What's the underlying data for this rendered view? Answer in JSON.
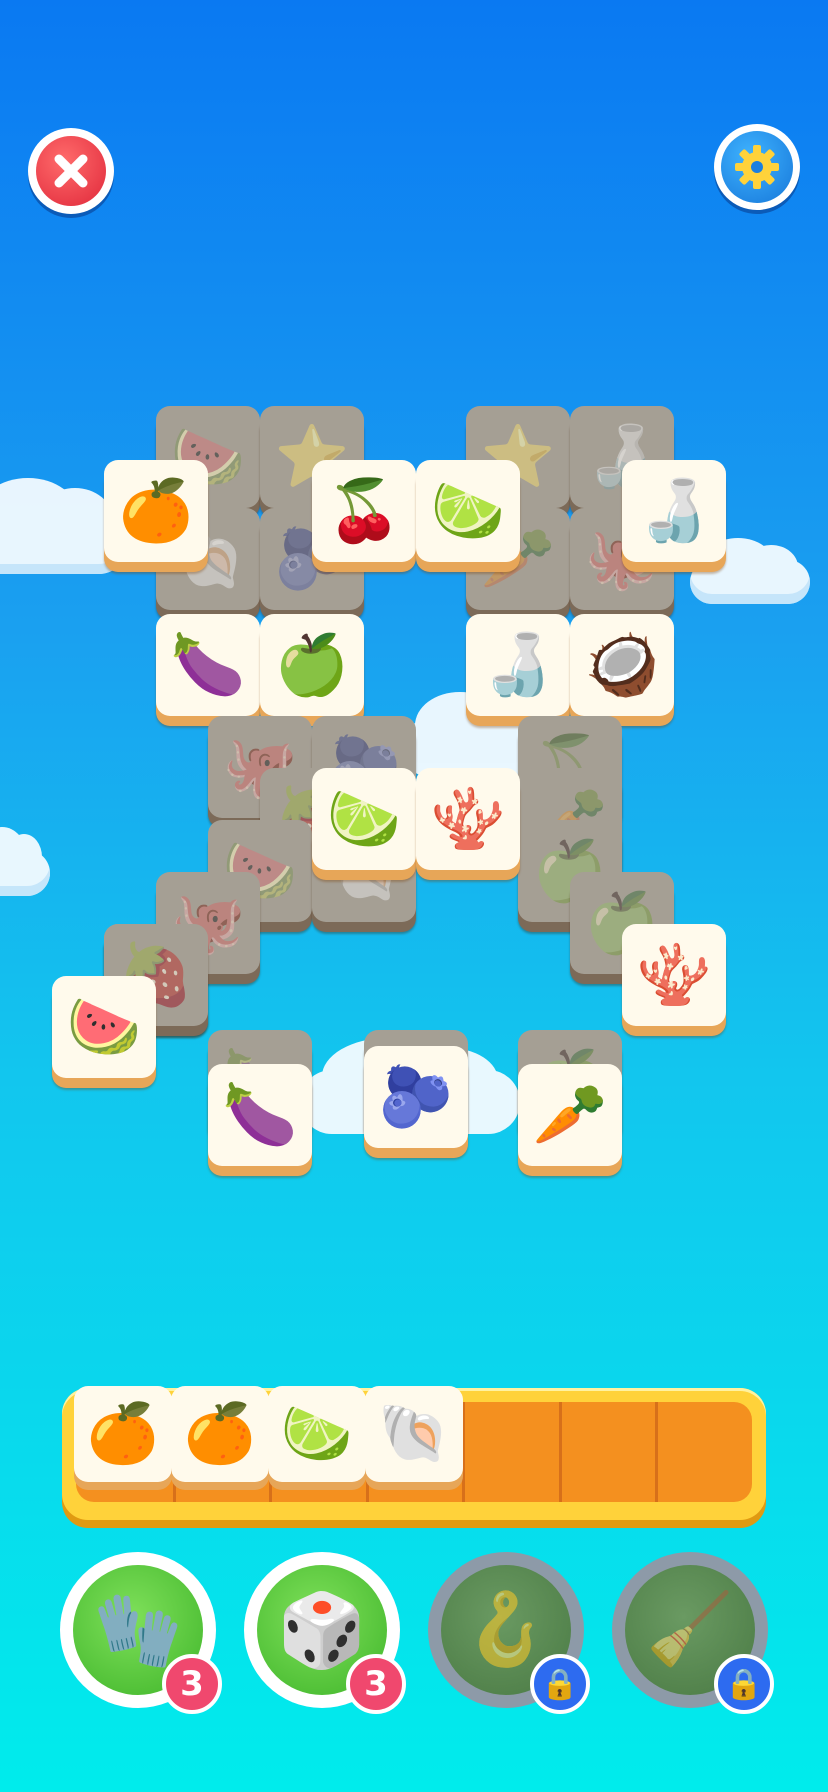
{
  "top_bar": {
    "close_icon": "close-icon",
    "settings_icon": "gear-icon"
  },
  "tiles": [
    {
      "glyph": "🍉",
      "dim": true
    },
    {
      "glyph": "⭐",
      "dim": true
    },
    {
      "glyph": "⭐",
      "dim": true
    },
    {
      "glyph": "🍶",
      "dim": true
    },
    {
      "glyph": "🐚",
      "dim": true
    },
    {
      "glyph": "🫐",
      "dim": true
    },
    {
      "glyph": "🥕",
      "dim": true
    },
    {
      "glyph": "🐙",
      "dim": true
    },
    {
      "glyph": "🍊",
      "dim": false
    },
    {
      "glyph": "🍒",
      "dim": false
    },
    {
      "glyph": "🍋‍🟩",
      "dim": false
    },
    {
      "glyph": "🍶",
      "dim": false
    },
    {
      "glyph": "🍆",
      "dim": false
    },
    {
      "glyph": "🍏",
      "dim": false
    },
    {
      "glyph": "🍶",
      "dim": false
    },
    {
      "glyph": "🥥",
      "dim": false
    },
    {
      "glyph": "🐙",
      "dim": true
    },
    {
      "glyph": "🫐",
      "dim": true
    },
    {
      "glyph": "🍒",
      "dim": true
    },
    {
      "glyph": "🍓",
      "dim": true
    },
    {
      "glyph": "🥕",
      "dim": true
    },
    {
      "glyph": "🍉",
      "dim": true
    },
    {
      "glyph": "🐚",
      "dim": true
    },
    {
      "glyph": "🍏",
      "dim": true
    },
    {
      "glyph": "🍓",
      "dim": true
    },
    {
      "glyph": "🍋‍🟩",
      "dim": false
    },
    {
      "glyph": "🪸",
      "dim": false
    },
    {
      "glyph": "🐙",
      "dim": true
    },
    {
      "glyph": "🍏",
      "dim": true
    },
    {
      "glyph": "🍓",
      "dim": true
    },
    {
      "glyph": "🪸",
      "dim": false
    },
    {
      "glyph": "🍉",
      "dim": false
    },
    {
      "glyph": "🍆",
      "dim": true
    },
    {
      "glyph": "🥥",
      "dim": true
    },
    {
      "glyph": "🍏",
      "dim": true
    },
    {
      "glyph": "🍆",
      "dim": false
    },
    {
      "glyph": "🫐",
      "dim": false
    },
    {
      "glyph": "🥕",
      "dim": false
    }
  ],
  "tray": {
    "slots_total": 7,
    "items": [
      {
        "glyph": "🍊"
      },
      {
        "glyph": "🍊"
      },
      {
        "glyph": "🍋‍🟩"
      },
      {
        "glyph": "🐚"
      }
    ]
  },
  "boosters": [
    {
      "name": "glove-icon",
      "glyph": "🧤",
      "count": "3",
      "locked": false
    },
    {
      "name": "dice-icon",
      "glyph": "🎲",
      "count": "3",
      "locked": false
    },
    {
      "name": "hook-icon",
      "glyph": "🪝",
      "count": "",
      "locked": true
    },
    {
      "name": "broom-icon",
      "glyph": "🧹",
      "count": "",
      "locked": true
    }
  ]
}
